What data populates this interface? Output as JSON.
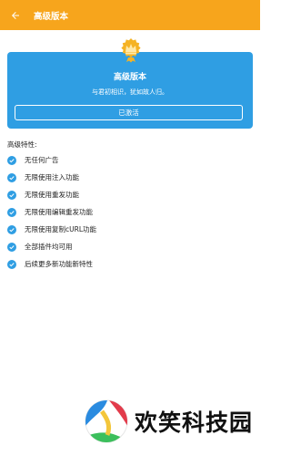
{
  "appbar": {
    "title": "高级版本",
    "back_icon": "arrow-left-icon",
    "color": "#f7a51c"
  },
  "card": {
    "badge_icon": "crown-badge-icon",
    "title": "高级版本",
    "subtitle": "与君初相识，犹如故人归。",
    "button_label": "已激活",
    "color": "#2f9ee3"
  },
  "features": {
    "heading": "高级特性:",
    "check_icon": "check-circle-icon",
    "items": [
      "无任何广告",
      "无限使用注入功能",
      "无限使用重发功能",
      "无限使用编辑重发功能",
      "无限使用复制cURL功能",
      "全部插件均可用",
      "后续更多新功能新特性"
    ]
  },
  "watermark": {
    "text": "欢笑科技园",
    "icon": "volleyball-logo-icon"
  }
}
